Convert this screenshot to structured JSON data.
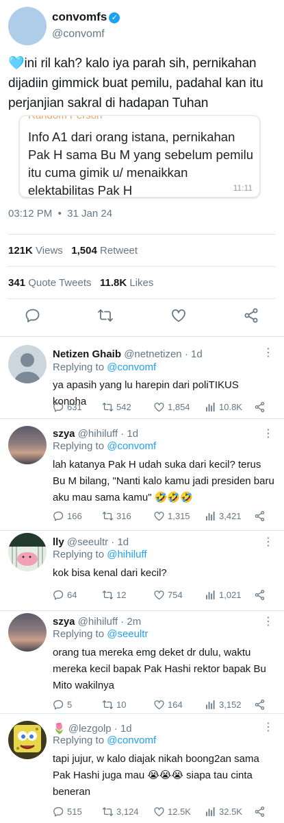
{
  "main_tweet": {
    "display_name": "convomfs",
    "handle": "@convomf",
    "verified_glyph": "✓",
    "text": "🩵ini ril kah? kalo iya parah sih, pernikahan dijadiin gimmick buat pemilu, padahal kan itu perjanjian sakral di hadapan Tuhan",
    "quoted_message": {
      "sender": "Random Person",
      "text": "Info A1 dari orang istana, pernikahan Pak H sama Bu M yang sebelum pemilu itu cuma gimik u/ menaikkan elektabilitas Pak H",
      "time": "11:11"
    },
    "time": "03:12 PM",
    "dot": "•",
    "date": "31 Jan 24",
    "views_count": "121K",
    "views_label": "Views",
    "retweet_count": "1,504",
    "retweet_label": "Retweet",
    "quote_count": "341",
    "quote_label": "Quote Tweets",
    "likes_count": "11.8K",
    "likes_label": "Likes",
    "actions": [
      "reply-icon",
      "retweet-icon",
      "like-icon",
      "share-icon"
    ]
  },
  "replies": [
    {
      "name": "Netizen Ghaib",
      "handle": "@netnetizen",
      "sep": "·",
      "age": "1d",
      "replying_label": "Replying to",
      "replying_to": "@convomf",
      "text": "ya apasih yang lu harepin dari poliTIKUS konoha",
      "replies": "631",
      "retweets": "542",
      "likes": "1,854",
      "views": "10.8K"
    },
    {
      "name": "szya",
      "handle": "@hihiluff",
      "sep": "·",
      "age": "1d",
      "replying_label": "Replying to",
      "replying_to": "@convomf",
      "text": "lah katanya Pak H udah suka dari kecil? terus Bu M bilang, \"Nanti kalo kamu jadi presiden baru aku mau sama kamu\" 🤣🤣🤣",
      "replies": "166",
      "retweets": "316",
      "likes": "1,315",
      "views": "3,421"
    },
    {
      "name": "lly",
      "handle": "@seeultr",
      "sep": "·",
      "age": "1d",
      "replying_label": "Replying to",
      "replying_to": "@hihiluff",
      "text": "kok bisa kenal dari kecil?",
      "replies": "64",
      "retweets": "12",
      "likes": "754",
      "views": "1,021"
    },
    {
      "name": "szya",
      "handle": "@hihiluff",
      "sep": "·",
      "age": "2m",
      "replying_label": "Replying to",
      "replying_to": "@seeultr",
      "text": "orang tua mereka emg deket dr dulu, waktu mereka kecil bapak Pak Hashi rektor bapak Bu Mito wakilnya",
      "replies": "5",
      "retweets": "10",
      "likes": "164",
      "views": "3,152"
    },
    {
      "name": "🌷",
      "handle": "@lezgolp",
      "sep": "·",
      "age": "1d",
      "replying_label": "Replying to",
      "replying_to": "@convomf",
      "text": "tapi jujur, w kalo diajak nikah boong2an sama Pak Hashi juga mau 😭😭😭 siapa tau cinta beneran",
      "replies": "515",
      "retweets": "3,124",
      "likes": "12.5K",
      "views": "32.5K"
    }
  ],
  "colors": {
    "accent": "#1da1f2",
    "muted": "#657786",
    "divider": "#e1e8ed"
  }
}
